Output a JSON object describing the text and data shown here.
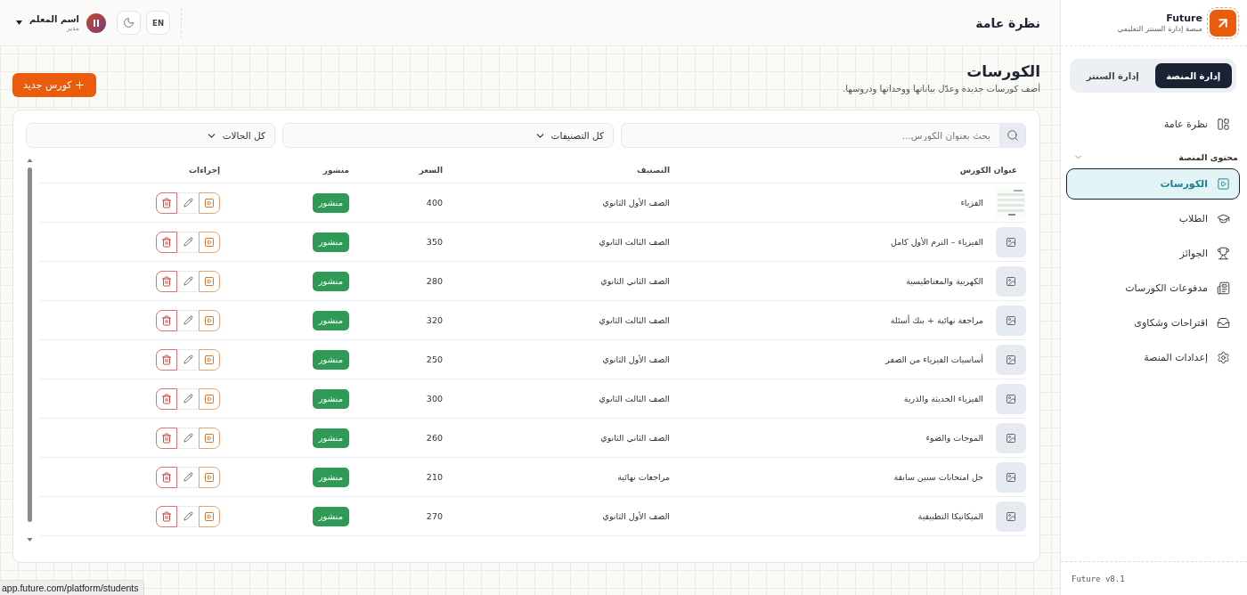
{
  "sidebar": {
    "brand": {
      "name": "Future",
      "tagline": "منصة إدارة السنتر التعليمي"
    },
    "modes": [
      {
        "label": "إدارة المنصة",
        "selected": true
      },
      {
        "label": "إدارة السنتر",
        "selected": false
      }
    ],
    "items": [
      {
        "label": "نظرة عامة",
        "selected": false
      }
    ],
    "group": {
      "label": "محتوى المنصة",
      "expanded": true,
      "children": [
        {
          "label": "الكورسات",
          "selected": true
        },
        {
          "label": "الطلاب",
          "selected": false
        },
        {
          "label": "الجوائز",
          "selected": false
        },
        {
          "label": "مدفوعات الكورسات",
          "selected": false
        },
        {
          "label": "اقتراحات وشكاوى",
          "selected": false
        },
        {
          "label": "إعدادات المنصة",
          "selected": false
        }
      ]
    },
    "version": "Future v8.1"
  },
  "topbar": {
    "title": "نظرة عامة",
    "language": "EN",
    "user": {
      "name": "اسم المعلم",
      "role": "مدير"
    }
  },
  "page": {
    "title": "الكورسات",
    "subtitle": "أضف كورسات جديدة وعدّل بياناتها ووحداتها ودروسها.",
    "new_button": "كورس جديد"
  },
  "filters": {
    "search": {
      "placeholder": "بحث بعنوان الكورس..."
    },
    "category": "كل التصنيفات",
    "status": "كل الحالات"
  },
  "table": {
    "columns": [
      "عنوان الكورس",
      "التصنيف",
      "السعر",
      "منشور",
      "إجراءات"
    ],
    "rows": [
      {
        "kind": "picture",
        "title": "الفزياء",
        "category": "الصف الأول الثانوي",
        "price": "400",
        "published": true,
        "status": "منشور"
      },
      {
        "kind": "placeholder",
        "title": "الفيزياء – الترم الأول كامل",
        "category": "الصف الثالث الثانوي",
        "price": "350",
        "published": true,
        "status": "منشور"
      },
      {
        "kind": "placeholder",
        "title": "الكهربية والمغناطيسية",
        "category": "الصف الثاني الثانوي",
        "price": "280",
        "published": true,
        "status": "منشور"
      },
      {
        "kind": "placeholder",
        "title": "مراجعة نهائية + بنك أسئلة",
        "category": "الصف الثالث الثانوي",
        "price": "320",
        "published": true,
        "status": "منشور"
      },
      {
        "kind": "placeholder",
        "title": "أساسيات الفيزياء من الصفر",
        "category": "الصف الأول الثانوي",
        "price": "250",
        "published": true,
        "status": "منشور"
      },
      {
        "kind": "placeholder",
        "title": "الفيزياء الحديثة والذرية",
        "category": "الصف الثالث الثانوي",
        "price": "300",
        "published": true,
        "status": "منشور"
      },
      {
        "kind": "placeholder",
        "title": "الموجات والضوء",
        "category": "الصف الثاني الثانوي",
        "price": "260",
        "published": true,
        "status": "منشور"
      },
      {
        "kind": "placeholder",
        "title": "حل امتحانات سنين سابقة",
        "category": "مراجعات نهائية",
        "price": "210",
        "published": true,
        "status": "منشور"
      },
      {
        "kind": "placeholder",
        "title": "الميكانيكا التطبيقية",
        "category": "الصف الأول الثانوي",
        "price": "270",
        "published": true,
        "status": "منشور"
      }
    ]
  },
  "status_bar": "app.future.com/platform/students"
}
